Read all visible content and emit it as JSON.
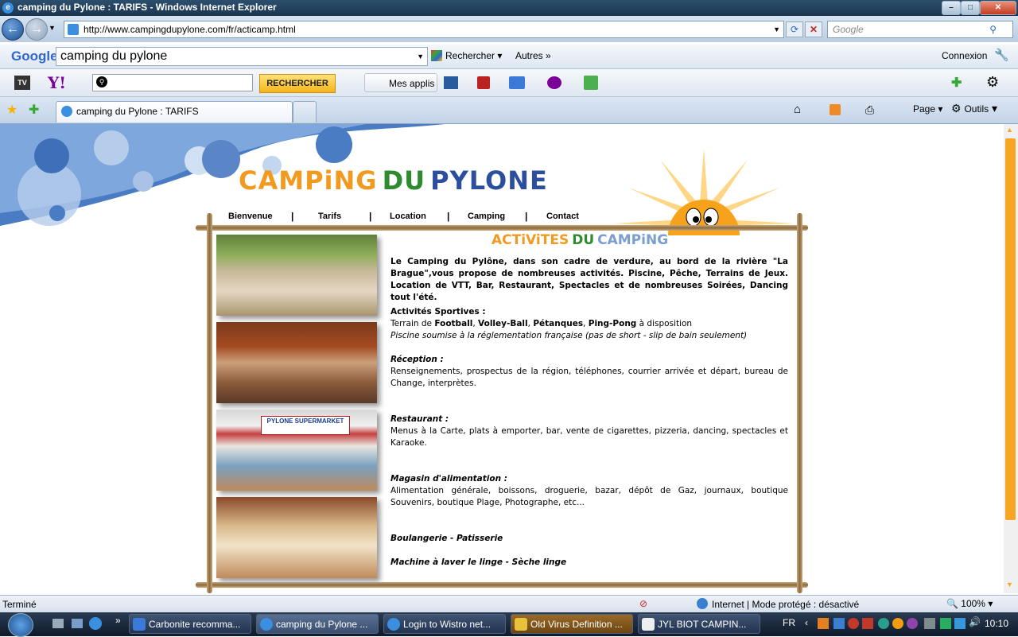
{
  "window": {
    "title": "camping du Pylone : TARIFS - Windows Internet Explorer"
  },
  "address": {
    "url": "http://www.campingdupylone.com/fr/acticamp.html",
    "search_placeholder": "Google"
  },
  "google_toolbar": {
    "logo": "Google",
    "query": "camping du pylone",
    "search_label": "Rechercher",
    "more_label": "Autres",
    "login_label": "Connexion"
  },
  "yahoo_toolbar": {
    "tv_label": "TV",
    "logo": "Y!",
    "search_button": "RECHERCHER",
    "apps_label": "Mes applis"
  },
  "tabs": {
    "active_tab": "camping du Pylone : TARIFS",
    "page_menu": "Page",
    "tools_menu": "Outils"
  },
  "site": {
    "logo_part1": "CAMPiNG",
    "logo_part2": "DU",
    "logo_part3": "PYLONE",
    "nav": [
      "Bienvenue",
      "Tarifs",
      "Location",
      "Camping",
      "Contact"
    ],
    "separator": "|",
    "heading_part1": "ACTiViTES",
    "heading_part2": "DU",
    "heading_part3": "CAMPiNG",
    "intro": "Le Camping du Pylône, dans son cadre de verdure, au bord de la rivière \"La Brague\",vous propose de nombreuses activités. Piscine, Pêche, Terrains de Jeux. Location de VTT, Bar, Restaurant, Spectacles et de nombreuses Soirées, Dancing tout l'été.",
    "sport_title": "Activités Sportives :",
    "sport_prefix": "Terrain de ",
    "sport_football": "Football",
    "sport_comma1": ", ",
    "sport_volley": "Volley-Ball",
    "sport_comma2": ", ",
    "sport_petanque": "Pétanques",
    "sport_comma3": ", ",
    "sport_pingpong": "Ping-Pong",
    "sport_suffix": " à disposition",
    "pool_note": "Piscine soumise à la réglementation française (pas de short - slip de bain seulement)",
    "reception_title": "Réception :",
    "reception_text": "Renseignements, prospectus de la région, téléphones, courrier arrivée et départ, bureau de Change, interprètes.",
    "restaurant_title": "Restaurant :",
    "restaurant_text": "Menus à la Carte, plats à emporter, bar, vente de cigarettes, pizzeria, dancing, spectacles et Karaoke.",
    "shop_title": "Magasin d'alimentation :",
    "shop_text": "Alimentation générale, boissons, droguerie, bazar, dépôt de Gaz, journaux, boutique Souvenirs, boutique Plage, Photographe, etc...",
    "bakery_title": "Boulangerie - Patisserie",
    "laundry_title": "Machine à laver le linge - Sèche linge",
    "shop_sign": "PYLONE SUPERMARKET"
  },
  "status": {
    "left": "Terminé",
    "zone": "Internet | Mode protégé : désactivé",
    "zoom": "100%"
  },
  "taskbar": {
    "tasks": [
      "Carbonite recomma...",
      "camping du Pylone ...",
      "Login to Wistro net...",
      "Old Virus Definition ...",
      "JYL  BIOT  CAMPIN..."
    ],
    "lang": "FR",
    "clock": "10:10"
  },
  "colors": {
    "accent_orange": "#f5a623",
    "logo_green": "#2e8b2e",
    "logo_blue": "#2b4f9e",
    "logo_orange": "#f29a1f"
  }
}
